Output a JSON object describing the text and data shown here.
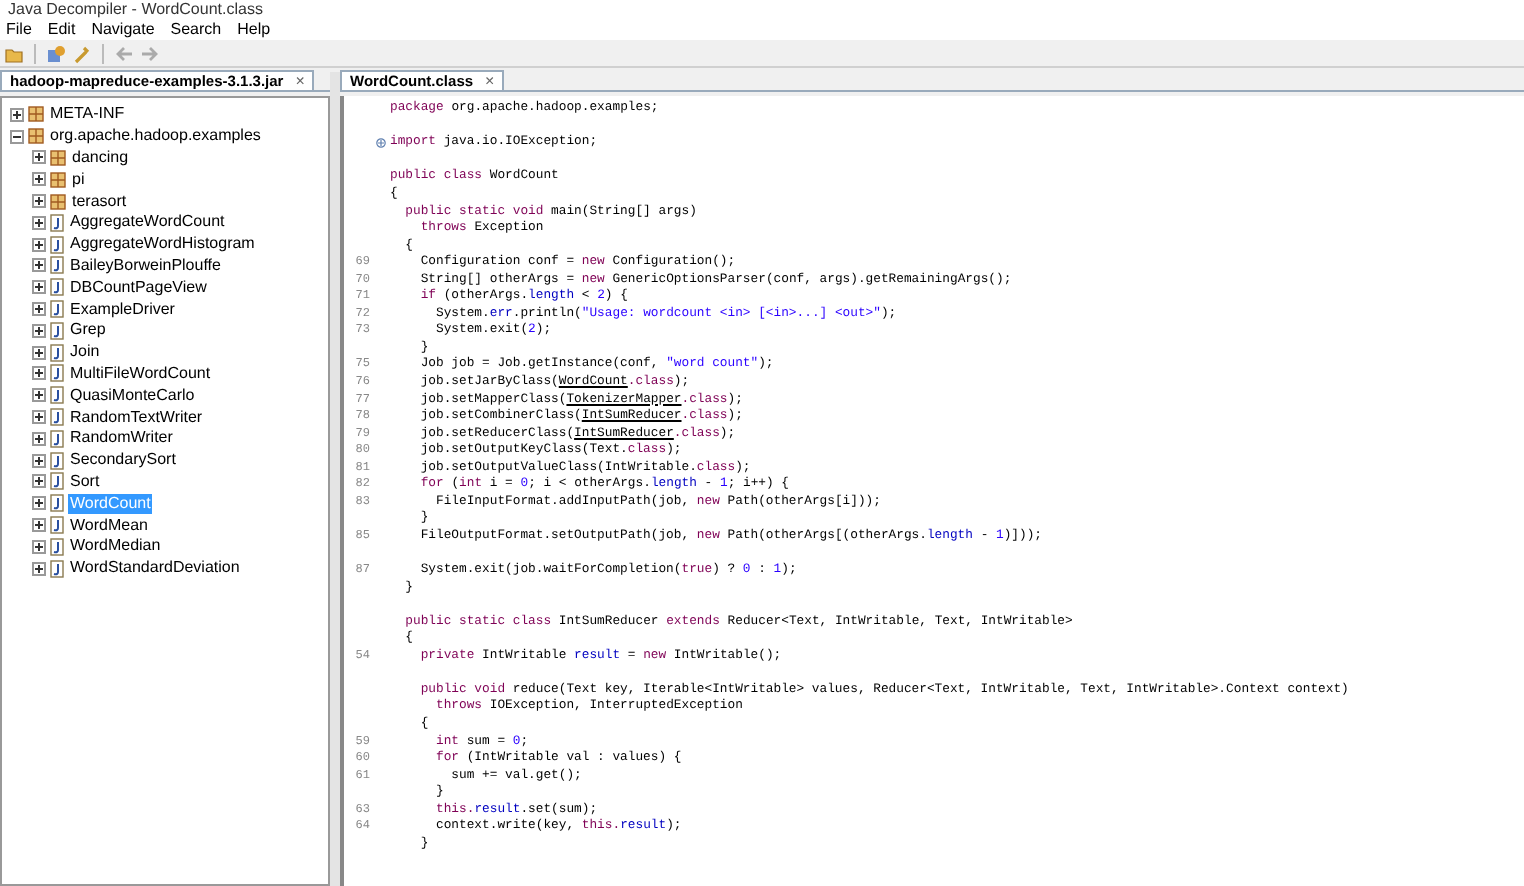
{
  "window": {
    "title": "Java Decompiler - WordCount.class"
  },
  "menu": [
    "File",
    "Edit",
    "Navigate",
    "Search",
    "Help"
  ],
  "toolbar": [
    {
      "kind": "open-folder"
    },
    {
      "kind": "separator"
    },
    {
      "kind": "open-type"
    },
    {
      "kind": "wrench"
    },
    {
      "kind": "separator"
    },
    {
      "kind": "back",
      "disabled": true
    },
    {
      "kind": "forward",
      "disabled": true
    }
  ],
  "left_tab": {
    "label": "hadoop-mapreduce-examples-3.1.3.jar",
    "close": "×"
  },
  "tree": [
    {
      "label": "META-INF",
      "kind": "package",
      "expanded": false,
      "selected": false
    },
    {
      "label": "org.apache.hadoop.examples",
      "kind": "package",
      "expanded": true,
      "selected": false,
      "children": [
        {
          "label": "dancing",
          "kind": "package",
          "expanded": false,
          "selected": false
        },
        {
          "label": "pi",
          "kind": "package",
          "expanded": false,
          "selected": false
        },
        {
          "label": "terasort",
          "kind": "package",
          "expanded": false,
          "selected": false
        },
        {
          "label": "AggregateWordCount",
          "kind": "class",
          "expanded": false,
          "selected": false
        },
        {
          "label": "AggregateWordHistogram",
          "kind": "class",
          "expanded": false,
          "selected": false
        },
        {
          "label": "BaileyBorweinPlouffe",
          "kind": "class",
          "expanded": false,
          "selected": false
        },
        {
          "label": "DBCountPageView",
          "kind": "class",
          "expanded": false,
          "selected": false
        },
        {
          "label": "ExampleDriver",
          "kind": "class",
          "expanded": false,
          "selected": false
        },
        {
          "label": "Grep",
          "kind": "class",
          "expanded": false,
          "selected": false
        },
        {
          "label": "Join",
          "kind": "class",
          "expanded": false,
          "selected": false
        },
        {
          "label": "MultiFileWordCount",
          "kind": "class",
          "expanded": false,
          "selected": false
        },
        {
          "label": "QuasiMonteCarlo",
          "kind": "class",
          "expanded": false,
          "selected": false
        },
        {
          "label": "RandomTextWriter",
          "kind": "class",
          "expanded": false,
          "selected": false
        },
        {
          "label": "RandomWriter",
          "kind": "class",
          "expanded": false,
          "selected": false
        },
        {
          "label": "SecondarySort",
          "kind": "class",
          "expanded": false,
          "selected": false
        },
        {
          "label": "Sort",
          "kind": "class",
          "expanded": false,
          "selected": false
        },
        {
          "label": "WordCount",
          "kind": "class",
          "expanded": false,
          "selected": true
        },
        {
          "label": "WordMean",
          "kind": "class",
          "expanded": false,
          "selected": false
        },
        {
          "label": "WordMedian",
          "kind": "class",
          "expanded": false,
          "selected": false
        },
        {
          "label": "WordStandardDeviation",
          "kind": "class",
          "expanded": false,
          "selected": false
        }
      ]
    }
  ],
  "editor_tab": {
    "label": "WordCount.class",
    "close": "×"
  },
  "code": [
    {
      "kind": "code",
      "tokens": [
        {
          "kind": "keyword",
          "text": "package"
        },
        {
          "kind": "plain",
          "text": " org.apache.hadoop.examples;"
        }
      ]
    },
    {
      "kind": "blank"
    },
    {
      "kind": "folded",
      "tokens": [
        {
          "kind": "keyword",
          "text": "import"
        },
        {
          "kind": "plain",
          "text": " java.io.IOException;"
        }
      ]
    },
    {
      "kind": "blank"
    },
    {
      "kind": "code",
      "tokens": [
        {
          "kind": "keyword",
          "text": "public class"
        },
        {
          "kind": "plain",
          "text": " WordCount"
        }
      ]
    },
    {
      "kind": "code",
      "tokens": [
        {
          "kind": "plain",
          "text": "{"
        }
      ]
    },
    {
      "kind": "code",
      "tokens": [
        {
          "kind": "keyword",
          "text": "  public static void"
        },
        {
          "kind": "plain",
          "text": " main(String[] args)"
        }
      ]
    },
    {
      "kind": "code",
      "tokens": [
        {
          "kind": "keyword",
          "text": "    throws"
        },
        {
          "kind": "plain",
          "text": " Exception"
        }
      ]
    },
    {
      "kind": "code",
      "tokens": [
        {
          "kind": "plain",
          "text": "  {"
        }
      ]
    },
    {
      "kind": "code",
      "number": "69",
      "tokens": [
        {
          "kind": "plain",
          "text": "    Configuration conf = "
        },
        {
          "kind": "keyword",
          "text": "new"
        },
        {
          "kind": "plain",
          "text": " Configuration();"
        }
      ]
    },
    {
      "kind": "code",
      "number": "70",
      "tokens": [
        {
          "kind": "plain",
          "text": "    String[] otherArgs = "
        },
        {
          "kind": "keyword",
          "text": "new"
        },
        {
          "kind": "plain",
          "text": " GenericOptionsParser(conf, args).getRemainingArgs();"
        }
      ]
    },
    {
      "kind": "code",
      "number": "71",
      "tokens": [
        {
          "kind": "keyword",
          "text": "    if"
        },
        {
          "kind": "plain",
          "text": " (otherArgs."
        },
        {
          "kind": "field",
          "text": "length"
        },
        {
          "kind": "plain",
          "text": " < "
        },
        {
          "kind": "number",
          "text": "2"
        },
        {
          "kind": "plain",
          "text": ") {"
        }
      ]
    },
    {
      "kind": "code",
      "number": "72",
      "tokens": [
        {
          "kind": "plain",
          "text": "      System."
        },
        {
          "kind": "field",
          "text": "err"
        },
        {
          "kind": "plain",
          "text": ".println("
        },
        {
          "kind": "string",
          "text": "\"Usage: wordcount <in> [<in>...] <out>\""
        },
        {
          "kind": "plain",
          "text": ");"
        }
      ]
    },
    {
      "kind": "code",
      "number": "73",
      "tokens": [
        {
          "kind": "plain",
          "text": "      System.exit("
        },
        {
          "kind": "number",
          "text": "2"
        },
        {
          "kind": "plain",
          "text": ");"
        }
      ]
    },
    {
      "kind": "code",
      "tokens": [
        {
          "kind": "plain",
          "text": "    }"
        }
      ]
    },
    {
      "kind": "code",
      "number": "75",
      "tokens": [
        {
          "kind": "plain",
          "text": "    Job job = Job.getInstance(conf, "
        },
        {
          "kind": "string",
          "text": "\"word count\""
        },
        {
          "kind": "plain",
          "text": ");"
        }
      ]
    },
    {
      "kind": "code",
      "number": "76",
      "tokens": [
        {
          "kind": "plain",
          "text": "    job.setJarByClass("
        },
        {
          "kind": "reference",
          "text": "WordCount"
        },
        {
          "kind": "keyword",
          "text": ".class"
        },
        {
          "kind": "plain",
          "text": ");"
        }
      ]
    },
    {
      "kind": "code",
      "number": "77",
      "tokens": [
        {
          "kind": "plain",
          "text": "    job.setMapperClass("
        },
        {
          "kind": "reference",
          "text": "TokenizerMapper"
        },
        {
          "kind": "keyword",
          "text": ".class"
        },
        {
          "kind": "plain",
          "text": ");"
        }
      ]
    },
    {
      "kind": "code",
      "number": "78",
      "tokens": [
        {
          "kind": "plain",
          "text": "    job.setCombinerClass("
        },
        {
          "kind": "reference",
          "text": "IntSumReducer"
        },
        {
          "kind": "keyword",
          "text": ".class"
        },
        {
          "kind": "plain",
          "text": ");"
        }
      ]
    },
    {
      "kind": "code",
      "number": "79",
      "tokens": [
        {
          "kind": "plain",
          "text": "    job.setReducerClass("
        },
        {
          "kind": "reference",
          "text": "IntSumReducer"
        },
        {
          "kind": "keyword",
          "text": ".class"
        },
        {
          "kind": "plain",
          "text": ");"
        }
      ]
    },
    {
      "kind": "code",
      "number": "80",
      "tokens": [
        {
          "kind": "plain",
          "text": "    job.setOutputKeyClass(Text."
        },
        {
          "kind": "keyword",
          "text": "class"
        },
        {
          "kind": "plain",
          "text": ");"
        }
      ]
    },
    {
      "kind": "code",
      "number": "81",
      "tokens": [
        {
          "kind": "plain",
          "text": "    job.setOutputValueClass(IntWritable."
        },
        {
          "kind": "keyword",
          "text": "class"
        },
        {
          "kind": "plain",
          "text": ");"
        }
      ]
    },
    {
      "kind": "code",
      "number": "82",
      "tokens": [
        {
          "kind": "keyword",
          "text": "    for"
        },
        {
          "kind": "plain",
          "text": " ("
        },
        {
          "kind": "keyword",
          "text": "int"
        },
        {
          "kind": "plain",
          "text": " i = "
        },
        {
          "kind": "number",
          "text": "0"
        },
        {
          "kind": "plain",
          "text": "; i < otherArgs."
        },
        {
          "kind": "field",
          "text": "length"
        },
        {
          "kind": "plain",
          "text": " - "
        },
        {
          "kind": "number",
          "text": "1"
        },
        {
          "kind": "plain",
          "text": "; i++) {"
        }
      ]
    },
    {
      "kind": "code",
      "number": "83",
      "tokens": [
        {
          "kind": "plain",
          "text": "      FileInputFormat.addInputPath(job, "
        },
        {
          "kind": "keyword",
          "text": "new"
        },
        {
          "kind": "plain",
          "text": " Path(otherArgs[i]));"
        }
      ]
    },
    {
      "kind": "code",
      "tokens": [
        {
          "kind": "plain",
          "text": "    }"
        }
      ]
    },
    {
      "kind": "code",
      "number": "85",
      "tokens": [
        {
          "kind": "plain",
          "text": "    FileOutputFormat.setOutputPath(job, "
        },
        {
          "kind": "keyword",
          "text": "new"
        },
        {
          "kind": "plain",
          "text": " Path(otherArgs[(otherArgs."
        },
        {
          "kind": "field",
          "text": "length"
        },
        {
          "kind": "plain",
          "text": " - "
        },
        {
          "kind": "number",
          "text": "1"
        },
        {
          "kind": "plain",
          "text": ")]));"
        }
      ]
    },
    {
      "kind": "blank"
    },
    {
      "kind": "code",
      "number": "87",
      "tokens": [
        {
          "kind": "plain",
          "text": "    System.exit(job.waitForCompletion("
        },
        {
          "kind": "keyword",
          "text": "true"
        },
        {
          "kind": "plain",
          "text": ") ? "
        },
        {
          "kind": "number",
          "text": "0"
        },
        {
          "kind": "plain",
          "text": " : "
        },
        {
          "kind": "number",
          "text": "1"
        },
        {
          "kind": "plain",
          "text": ");"
        }
      ]
    },
    {
      "kind": "code",
      "tokens": [
        {
          "kind": "plain",
          "text": "  }"
        }
      ]
    },
    {
      "kind": "blank"
    },
    {
      "kind": "code",
      "tokens": [
        {
          "kind": "keyword",
          "text": "  public static class"
        },
        {
          "kind": "plain",
          "text": " IntSumReducer "
        },
        {
          "kind": "keyword",
          "text": "extends"
        },
        {
          "kind": "plain",
          "text": " Reducer<Text, IntWritable, Text, IntWritable>"
        }
      ]
    },
    {
      "kind": "code",
      "tokens": [
        {
          "kind": "plain",
          "text": "  {"
        }
      ]
    },
    {
      "kind": "code",
      "number": "54",
      "tokens": [
        {
          "kind": "keyword",
          "text": "    private"
        },
        {
          "kind": "plain",
          "text": " IntWritable "
        },
        {
          "kind": "field",
          "text": "result"
        },
        {
          "kind": "plain",
          "text": " = "
        },
        {
          "kind": "keyword",
          "text": "new"
        },
        {
          "kind": "plain",
          "text": " IntWritable();"
        }
      ]
    },
    {
      "kind": "blank"
    },
    {
      "kind": "code",
      "tokens": [
        {
          "kind": "keyword",
          "text": "    public void"
        },
        {
          "kind": "plain",
          "text": " reduce(Text key, Iterable<IntWritable> values, Reducer<Text, IntWritable, Text, IntWritable>.Context context)"
        }
      ]
    },
    {
      "kind": "code",
      "tokens": [
        {
          "kind": "keyword",
          "text": "      throws"
        },
        {
          "kind": "plain",
          "text": " IOException, InterruptedException"
        }
      ]
    },
    {
      "kind": "code",
      "tokens": [
        {
          "kind": "plain",
          "text": "    {"
        }
      ]
    },
    {
      "kind": "code",
      "number": "59",
      "tokens": [
        {
          "kind": "keyword",
          "text": "      int"
        },
        {
          "kind": "plain",
          "text": " sum = "
        },
        {
          "kind": "number",
          "text": "0"
        },
        {
          "kind": "plain",
          "text": ";"
        }
      ]
    },
    {
      "kind": "code",
      "number": "60",
      "tokens": [
        {
          "kind": "keyword",
          "text": "      for"
        },
        {
          "kind": "plain",
          "text": " (IntWritable val : values) {"
        }
      ]
    },
    {
      "kind": "code",
      "number": "61",
      "tokens": [
        {
          "kind": "plain",
          "text": "        sum += val.get();"
        }
      ]
    },
    {
      "kind": "code",
      "tokens": [
        {
          "kind": "plain",
          "text": "      }"
        }
      ]
    },
    {
      "kind": "code",
      "number": "63",
      "tokens": [
        {
          "kind": "keyword",
          "text": "      this."
        },
        {
          "kind": "field",
          "text": "result"
        },
        {
          "kind": "plain",
          "text": ".set(sum);"
        }
      ]
    },
    {
      "kind": "code",
      "number": "64",
      "tokens": [
        {
          "kind": "plain",
          "text": "      context.write(key, "
        },
        {
          "kind": "keyword",
          "text": "this."
        },
        {
          "kind": "field",
          "text": "result"
        },
        {
          "kind": "plain",
          "text": ");"
        }
      ]
    },
    {
      "kind": "code",
      "tokens": [
        {
          "kind": "plain",
          "text": "    }"
        }
      ]
    }
  ]
}
